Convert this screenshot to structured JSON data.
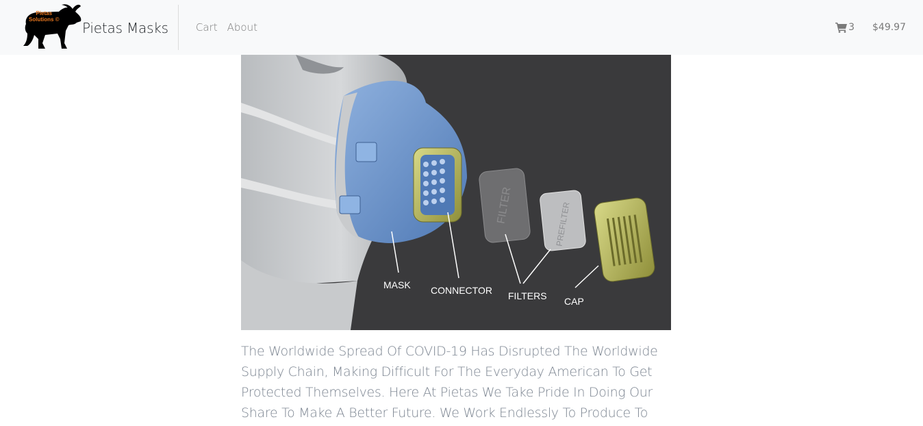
{
  "nav": {
    "logo_text_line1": "Pietas",
    "logo_text_line2": "Solutions ©",
    "brand": "Pietas Masks",
    "links": [
      {
        "label": "Cart"
      },
      {
        "label": "About"
      }
    ],
    "cart_count": "3",
    "cart_total": "$49.97"
  },
  "hero": {
    "labels": {
      "mask": "MASK",
      "connector": "CONNECTOR",
      "filters": "FILTERS",
      "cap": "CAP",
      "filter_embossed": "FILTER",
      "prefilter_embossed": "PREFILTER"
    }
  },
  "description": "The Worldwide Spread Of COVID-19 Has Disrupted The Worldwide Supply Chain, Making Difficult For The Everyday American To Get Protected Themselves. Here At Pietas We Take Pride In Doing Our Share To Make A Better Future. We Work Endlessly To Produce To Most Innovative Designs.",
  "colors": {
    "navbar_bg": "#f8f9fa",
    "muted_text": "#7a7a7a",
    "hero_bg": "#3a3a3c",
    "logo_text": "#e8761e"
  }
}
